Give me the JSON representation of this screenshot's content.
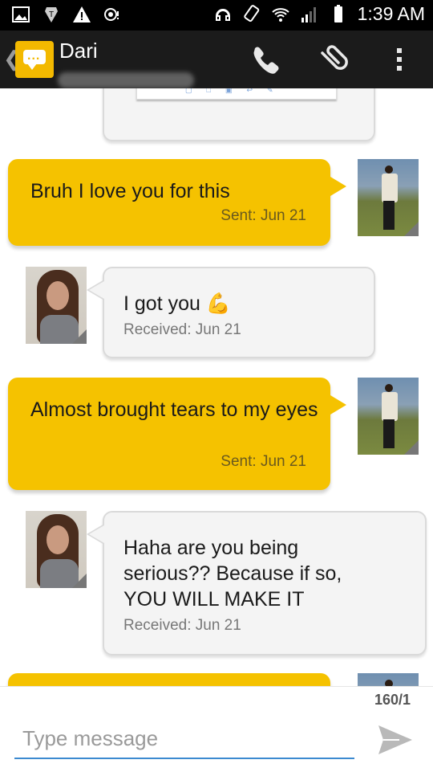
{
  "status_bar": {
    "time": "1:39 AM",
    "icons": [
      "gallery-icon",
      "tmobile-icon",
      "warning-icon",
      "voicemail-icon",
      "headset-icon",
      "rotate-icon",
      "wifi-icon",
      "signal-icon",
      "battery-icon"
    ]
  },
  "action_bar": {
    "contact_name": "Dari",
    "back_icon": "chevron-left-icon",
    "app_icon": "messages-app-icon",
    "actions": [
      "phone-icon",
      "paperclip-icon",
      "overflow-menu-icon"
    ]
  },
  "messages": [
    {
      "direction": "sent",
      "text": "Bruh I love you for this",
      "meta": "Sent: Jun 21"
    },
    {
      "direction": "received",
      "text": "I got you 💪",
      "meta": "Received: Jun 21"
    },
    {
      "direction": "sent",
      "text": "Almost brought tears to my eyes",
      "meta": "Sent: Jun 21"
    },
    {
      "direction": "received",
      "text": "Haha are you being serious?? Because if so, YOU WILL MAKE IT",
      "meta": "Received: Jun 21"
    }
  ],
  "compose": {
    "counter": "160/1",
    "placeholder": "Type message",
    "value": ""
  },
  "colors": {
    "sent_bubble": "#f5c200",
    "received_bubble": "#f4f4f4",
    "action_bar": "#1b1b1b",
    "input_underline": "#3c8ad0"
  }
}
